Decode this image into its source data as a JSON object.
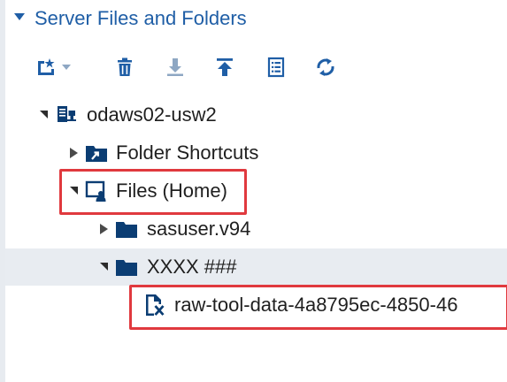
{
  "pane": {
    "title": "Server Files and Folders"
  },
  "toolbar": {
    "tools": [
      {
        "name": "new",
        "icon": "new-item-icon",
        "has_dropdown": true
      },
      {
        "name": "delete",
        "icon": "trash-icon"
      },
      {
        "name": "download",
        "icon": "download-icon"
      },
      {
        "name": "upload",
        "icon": "upload-icon"
      },
      {
        "name": "properties",
        "icon": "properties-list-icon"
      },
      {
        "name": "refresh",
        "icon": "refresh-icon"
      }
    ]
  },
  "tree": {
    "server": {
      "label": "odaws02-usw2",
      "expanded": true
    },
    "folder_shortcuts": {
      "label": "Folder Shortcuts",
      "expanded": false
    },
    "files_home": {
      "label": "Files (Home)",
      "expanded": true,
      "highlighted": true
    },
    "sasuser": {
      "label": "sasuser.v94",
      "expanded": false
    },
    "xxxx": {
      "label": "XXXX ###",
      "expanded": true,
      "selected": true
    },
    "raw_file": {
      "label": "raw-tool-data-4a8795ec-4850-46",
      "highlighted": true
    }
  },
  "colors": {
    "accent": "#1f5ea6",
    "folder": "#0b3d73",
    "highlight": "#e0393e",
    "selected_row": "#e8ecf1"
  }
}
